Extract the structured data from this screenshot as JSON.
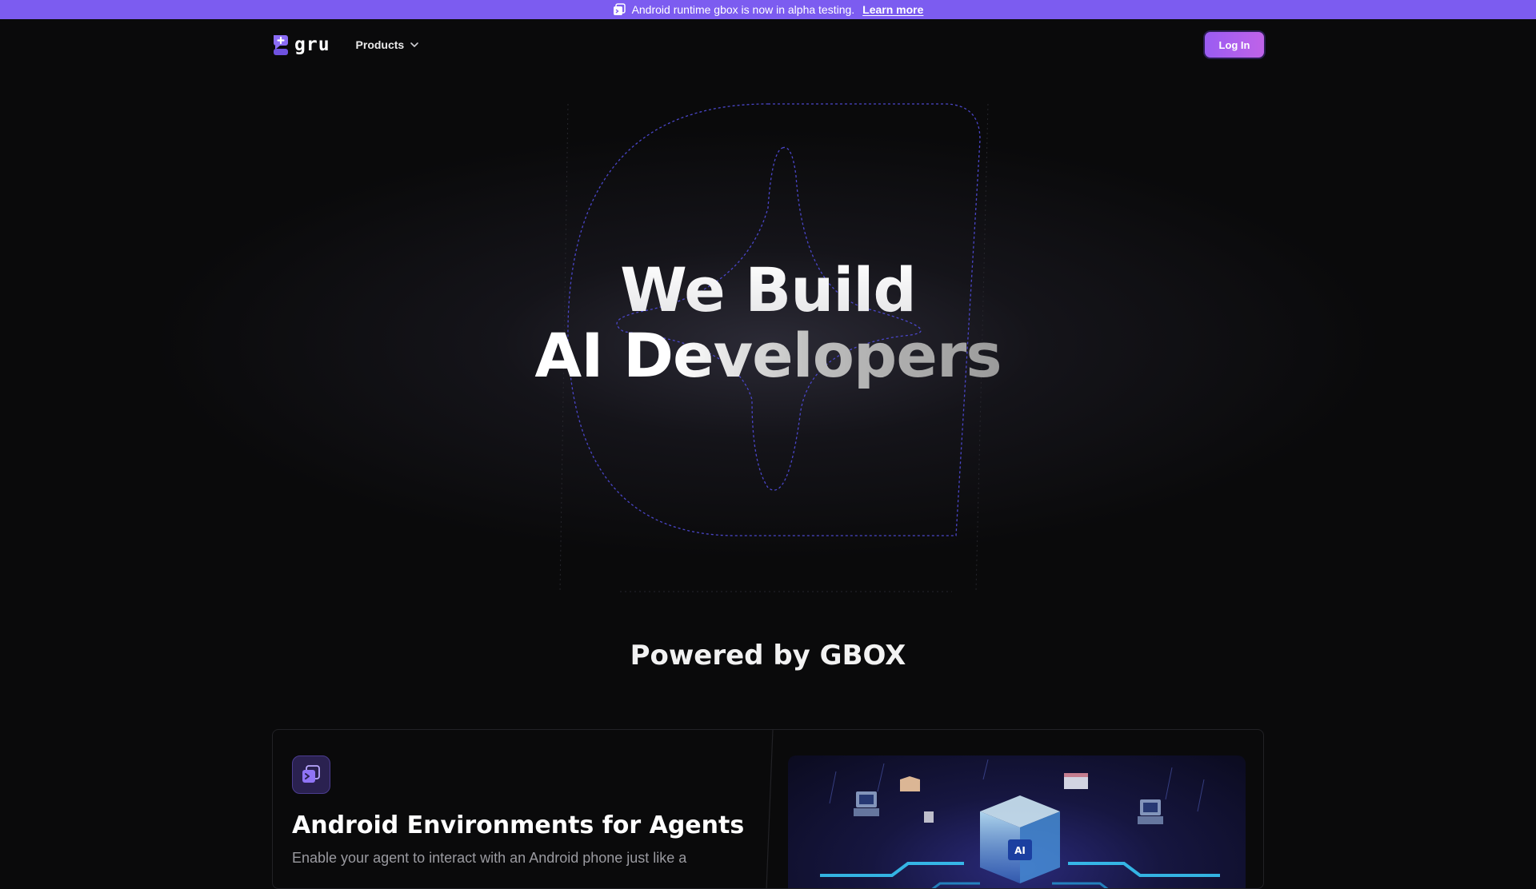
{
  "announcement": {
    "text": "Android runtime gbox is now in alpha testing.",
    "link_label": "Learn more"
  },
  "header": {
    "logo_text": "gru",
    "nav_products_label": "Products",
    "login_label": "Log In"
  },
  "hero": {
    "title_line1": "We Build",
    "title_line2": "AI Developers"
  },
  "powered": {
    "title": "Powered by GBOX"
  },
  "feature": {
    "title": "Android Environments for Agents",
    "description": "Enable your agent to interact with an Android phone just like a",
    "image_label": "AI"
  },
  "colors": {
    "accent": "#7c5cf0",
    "login_gradient_start": "#9a5cf2",
    "login_gradient_end": "#bf63e8",
    "background": "#0a0a0b",
    "deco_stroke": "#4a46c8"
  },
  "icons": {
    "announcement": "gbox-icon",
    "logo": "gru-logo-icon",
    "products_chevron": "chevron-down-icon",
    "feature": "gbox-terminal-icon"
  }
}
